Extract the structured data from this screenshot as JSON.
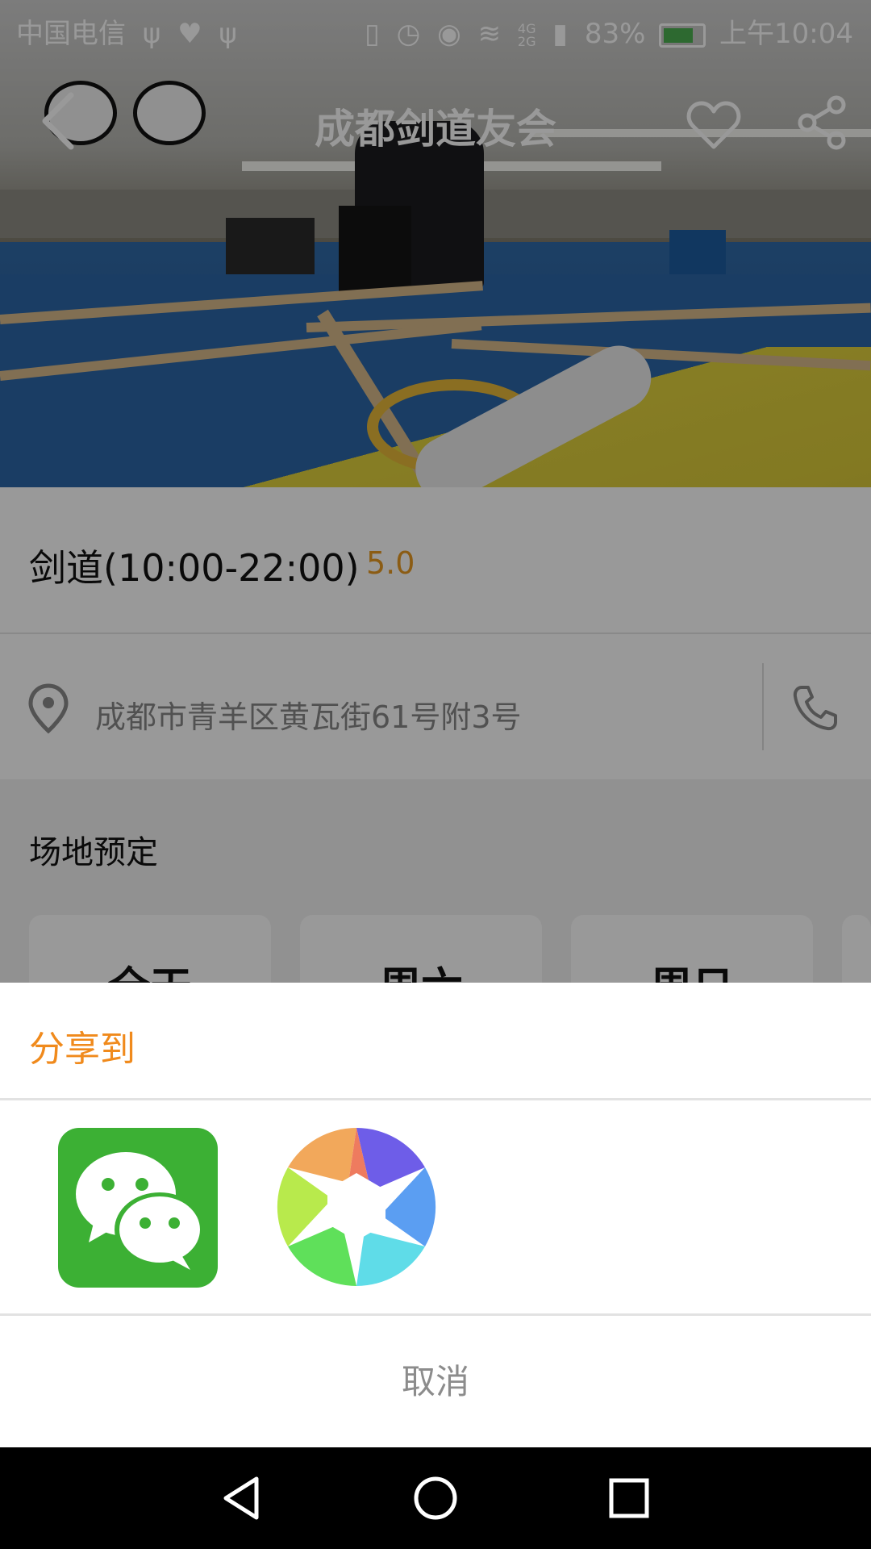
{
  "status_bar": {
    "carrier": "中国电信",
    "battery_percent": "83%",
    "time": "上午10:04",
    "network_label": "4G",
    "network_label_2": "2G",
    "left_icons": [
      "usb-icon",
      "health-icon",
      "usb-icon"
    ],
    "right_icons": [
      "vibrate-icon",
      "alarm-icon",
      "eye-comfort-icon",
      "wifi-icon",
      "signal-icon",
      "battery-icon"
    ]
  },
  "header": {
    "title": "成都剑道友会",
    "back_icon": "back-arrow-icon",
    "favorite_icon": "heart-icon",
    "share_icon": "share-icon"
  },
  "venue": {
    "name": "剑道(10:00-22:00)",
    "rating": "5.0",
    "address": "成都市青羊区黄瓦街61号附3号"
  },
  "booking": {
    "title": "场地预定",
    "days": [
      "全天",
      "周六",
      "周日"
    ]
  },
  "share_sheet": {
    "title": "分享到",
    "targets": [
      {
        "name": "wechat",
        "icon": "wechat-icon"
      },
      {
        "name": "moments",
        "icon": "moments-icon"
      }
    ],
    "cancel_label": "取消"
  },
  "colors": {
    "accent_orange": "#f08a1c",
    "rating_orange": "#e89a22",
    "wechat_green": "#3cb034"
  },
  "nav_bar": {
    "icons": [
      "nav-back-icon",
      "nav-home-icon",
      "nav-recents-icon"
    ]
  }
}
